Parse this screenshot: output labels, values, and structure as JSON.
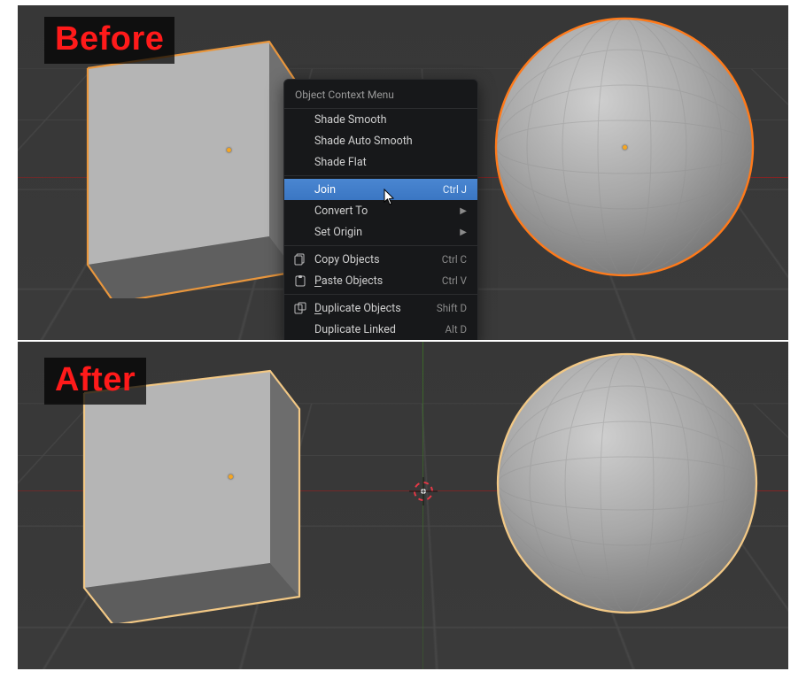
{
  "labels": {
    "before": "Before",
    "after": "After"
  },
  "context_menu": {
    "title": "Object Context Menu",
    "items": {
      "shade_smooth": {
        "label": "Shade Smooth"
      },
      "shade_auto": {
        "label": "Shade Auto Smooth"
      },
      "shade_flat": {
        "label": "Shade Flat"
      },
      "join": {
        "label": "Join",
        "shortcut": "Ctrl J"
      },
      "convert_to": {
        "label": "Convert To"
      },
      "set_origin": {
        "label": "Set Origin"
      },
      "copy_objects": {
        "label": "Copy Objects",
        "shortcut": "Ctrl C"
      },
      "paste_objects": {
        "label": "Paste Objects",
        "shortcut": "Ctrl V"
      },
      "dup_objects": {
        "label": "Duplicate Objects",
        "shortcut": "Shift D"
      },
      "dup_linked": {
        "label": "Duplicate Linked",
        "shortcut": "Alt D"
      }
    }
  },
  "scene": {
    "before": {
      "cube": {
        "selection": "secondary",
        "outline": "#f2a94a"
      },
      "sphere": {
        "selection": "active",
        "outline": "#ff7a1a"
      }
    },
    "after": {
      "cube": {
        "selection": "active",
        "outline": "#f5c26b"
      },
      "sphere": {
        "selection": "active",
        "outline": "#f5c26b"
      }
    }
  },
  "icons": {
    "copy": "copy-icon",
    "paste": "paste-icon",
    "duplicate": "duplicate-icon",
    "submenu": "▶",
    "cursor": "arrow-cursor"
  }
}
